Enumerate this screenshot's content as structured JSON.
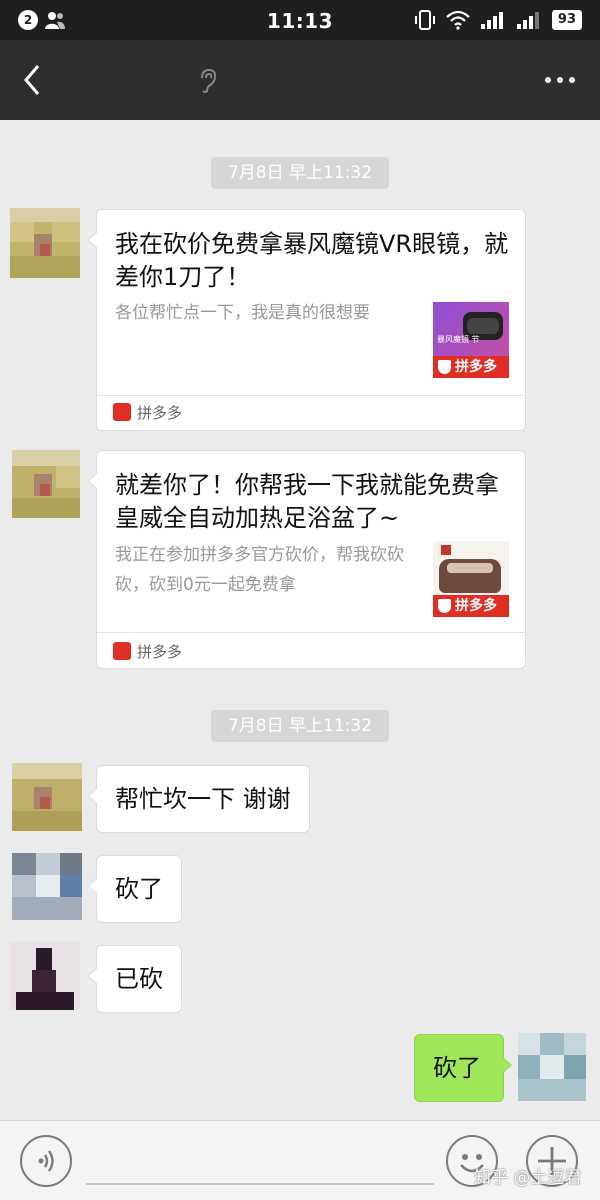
{
  "status_bar": {
    "notification_count": "2",
    "time": "11:13",
    "battery": "93",
    "icons": [
      "vibrate-icon",
      "wifi-icon",
      "signal-icon",
      "signal-2-icon",
      "battery-icon"
    ]
  },
  "title_bar": {
    "back_icon": "back-arrow-icon",
    "contact_name": "",
    "earpiece_icon": "ear-icon",
    "more_icon": "more-dots-icon"
  },
  "chat": {
    "timestamps": [
      "7月8日 早上11:32",
      "7月8日 早上11:32"
    ],
    "cards": [
      {
        "title": "我在砍价免费拿暴风魔镜VR眼镜，就差你1刀了！",
        "description": "各位帮忙点一下，我是真的很想要",
        "thumb_label": "拼多多",
        "thumb_caption": "暴风魔镜 节",
        "source": "拼多多"
      },
      {
        "title": "就差你了！你帮我一下我就能免费拿皇威全自动加热足浴盆了~",
        "description": "我正在参加拼多多官方砍价，帮我砍砍砍，砍到0元一起免费拿",
        "thumb_label": "拼多多",
        "source": "拼多多"
      }
    ],
    "messages": [
      {
        "text": "帮忙坎一下 谢谢",
        "side": "left"
      },
      {
        "text": "砍了",
        "side": "left"
      },
      {
        "text": "已砍",
        "side": "left"
      },
      {
        "text": "砍了",
        "side": "right"
      }
    ]
  },
  "input_bar": {
    "voice_icon": "voice-icon",
    "emoji_icon": "emoji-icon",
    "plus_icon": "plus-icon",
    "input_value": ""
  },
  "watermark": "知乎 @土逗君",
  "colors": {
    "chat_background": "#ebebeb",
    "title_bar": "#2e2e2e",
    "status_bar": "#1f1f1f",
    "sent_bubble": "#9fe658",
    "pinduoduo_red": "#e02e24"
  }
}
